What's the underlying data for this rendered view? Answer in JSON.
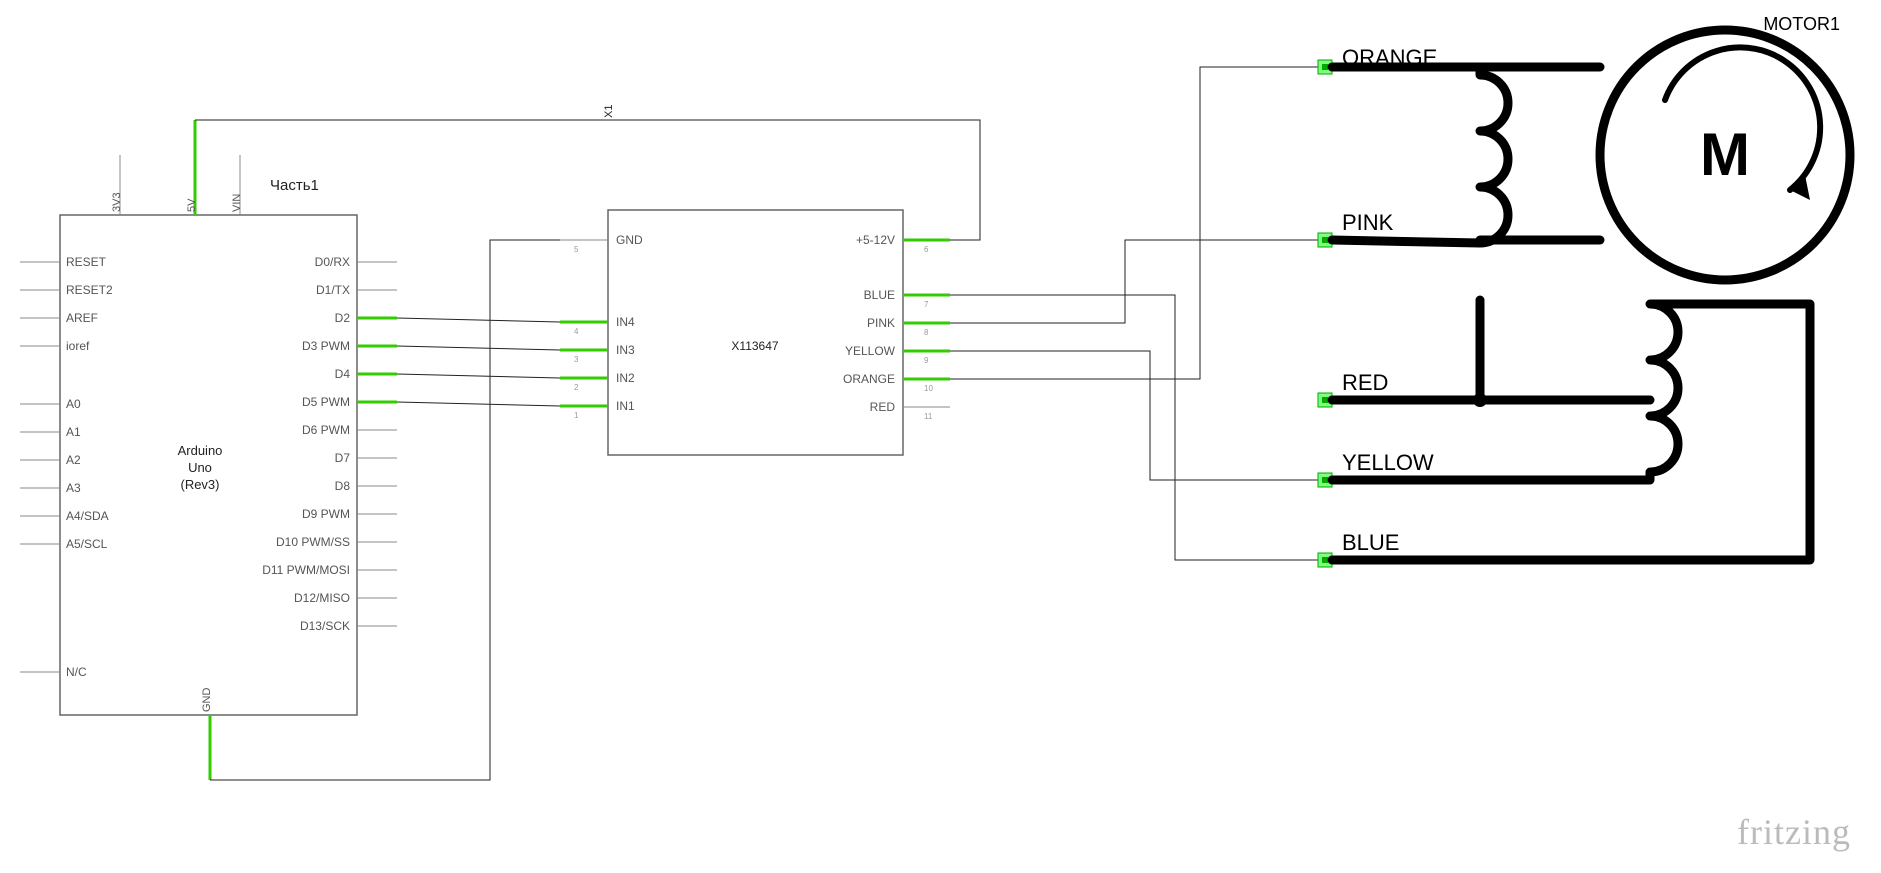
{
  "title_motor": "MOTOR1",
  "part1_label": "Часть1",
  "arduino": {
    "name_line1": "Arduino",
    "name_line2": "Uno",
    "name_line3": "(Rev3)",
    "top_pins": [
      "3V3",
      "5V",
      "VIN"
    ],
    "left_pins": [
      "RESET",
      "RESET2",
      "AREF",
      "ioref",
      "A0",
      "A1",
      "A2",
      "A3",
      "A4/SDA",
      "A5/SCL",
      "N/C"
    ],
    "right_pins": [
      "D0/RX",
      "D1/TX",
      "D2",
      "D3 PWM",
      "D4",
      "D5 PWM",
      "D6 PWM",
      "D7",
      "D8",
      "D9 PWM",
      "D10 PWM/SS",
      "D11 PWM/MOSI",
      "D12/MISO",
      "D13/SCK"
    ],
    "bottom_pin": "GND"
  },
  "driver": {
    "name": "X113647",
    "net_label": "X1",
    "left_pins": [
      {
        "num": "5",
        "label": "GND"
      },
      {
        "num": "4",
        "label": "IN4"
      },
      {
        "num": "3",
        "label": "IN3"
      },
      {
        "num": "2",
        "label": "IN2"
      },
      {
        "num": "1",
        "label": "IN1"
      }
    ],
    "right_pins": [
      {
        "num": "6",
        "label": "+5-12V"
      },
      {
        "num": "7",
        "label": "BLUE"
      },
      {
        "num": "8",
        "label": "PINK"
      },
      {
        "num": "9",
        "label": "YELLOW"
      },
      {
        "num": "10",
        "label": "ORANGE"
      },
      {
        "num": "11",
        "label": "RED"
      }
    ]
  },
  "motor_wires": [
    "ORANGE",
    "PINK",
    "RED",
    "YELLOW",
    "BLUE"
  ],
  "motor_letter": "M",
  "watermark": "fritzing"
}
